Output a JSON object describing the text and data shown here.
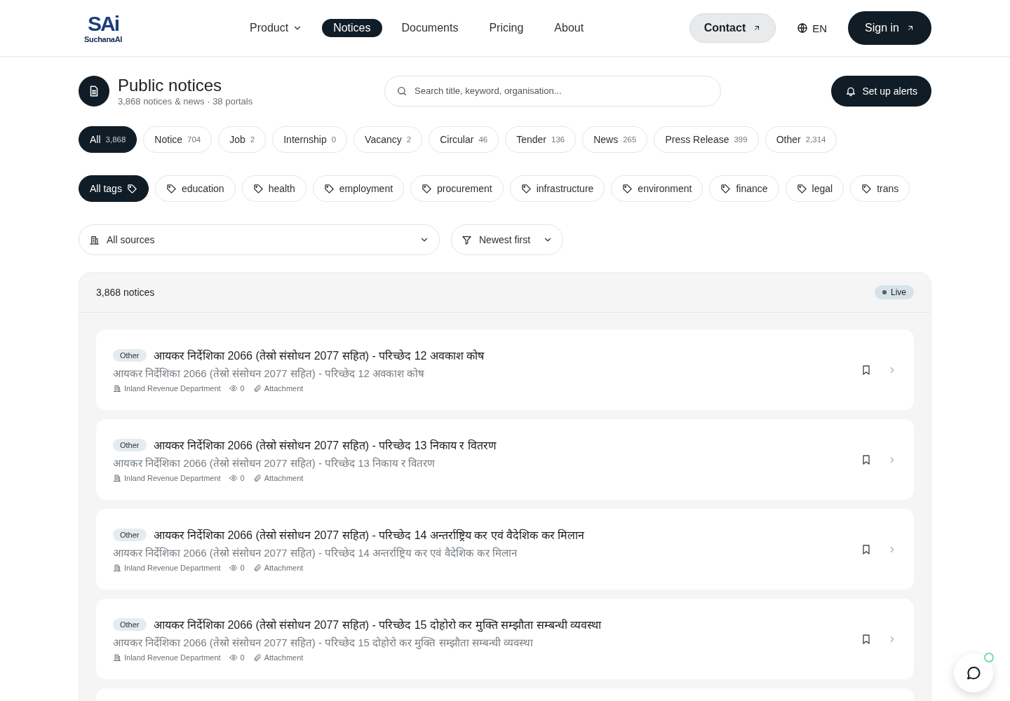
{
  "header": {
    "logo": {
      "mark": "SAi",
      "name": "SuchanaAI"
    },
    "nav": [
      {
        "label": "Product",
        "dropdown": true,
        "selected": false
      },
      {
        "label": "Notices",
        "dropdown": false,
        "selected": true
      },
      {
        "label": "Documents",
        "dropdown": false,
        "selected": false
      },
      {
        "label": "Pricing",
        "dropdown": false,
        "selected": false
      },
      {
        "label": "About",
        "dropdown": false,
        "selected": false
      }
    ],
    "contact": "Contact",
    "language": "EN",
    "sign_in": "Sign in"
  },
  "page": {
    "title": "Public notices",
    "subtitle": "3,868 notices & news · 38 portals",
    "search": {
      "placeholder": "Search title, keyword, organisation..."
    },
    "alerts_button": "Set up alerts"
  },
  "categories": [
    {
      "label": "All",
      "count": "3,868",
      "selected": true
    },
    {
      "label": "Notice",
      "count": "704",
      "selected": false
    },
    {
      "label": "Job",
      "count": "2",
      "selected": false
    },
    {
      "label": "Internship",
      "count": "0",
      "selected": false
    },
    {
      "label": "Vacancy",
      "count": "2",
      "selected": false
    },
    {
      "label": "Circular",
      "count": "46",
      "selected": false
    },
    {
      "label": "Tender",
      "count": "136",
      "selected": false
    },
    {
      "label": "News",
      "count": "265",
      "selected": false
    },
    {
      "label": "Press Release",
      "count": "399",
      "selected": false
    },
    {
      "label": "Other",
      "count": "2,314",
      "selected": false
    }
  ],
  "tags": [
    {
      "label": "All tags",
      "selected": true
    },
    {
      "label": "education",
      "selected": false
    },
    {
      "label": "health",
      "selected": false
    },
    {
      "label": "employment",
      "selected": false
    },
    {
      "label": "procurement",
      "selected": false
    },
    {
      "label": "infrastructure",
      "selected": false
    },
    {
      "label": "environment",
      "selected": false
    },
    {
      "label": "finance",
      "selected": false
    },
    {
      "label": "legal",
      "selected": false
    },
    {
      "label": "trans",
      "selected": false
    }
  ],
  "filters": {
    "source": "All sources",
    "sort": "Newest first"
  },
  "list": {
    "count": "3,868 notices",
    "status": "Live",
    "notices": [
      {
        "type": "Other",
        "title": "आयकर निर्देशिका 2066 (तेस्रो संसोधन 2077 सहित) - परिच्छेद 12 अवकाश कोष",
        "summary": "आयकर निर्देशिका 2066 (तेस्रो संसोधन 2077 सहित) - परिच्छेद 12 अवकाश कोष",
        "source": "Inland Revenue Department",
        "views": "0",
        "attachment": "Attachment"
      },
      {
        "type": "Other",
        "title": "आयकर निर्देशिका 2066 (तेस्रो संसोधन 2077 सहित) - परिच्छेद 13 निकाय र वितरण",
        "summary": "आयकर निर्देशिका 2066 (तेस्रो संसोधन 2077 सहित) - परिच्छेद 13 निकाय र वितरण",
        "source": "Inland Revenue Department",
        "views": "0",
        "attachment": "Attachment"
      },
      {
        "type": "Other",
        "title": "आयकर निर्देशिका 2066 (तेस्रो संसोधन 2077 सहित) - परिच्छेद 14 अन्तर्राष्ट्रिय कर एवं वैदेशिक कर मिलान",
        "summary": "आयकर निर्देशिका 2066 (तेस्रो संसोधन 2077 सहित) - परिच्छेद 14 अन्तर्राष्ट्रिय कर एवं वैदेशिक कर मिलान",
        "source": "Inland Revenue Department",
        "views": "0",
        "attachment": "Attachment"
      },
      {
        "type": "Other",
        "title": "आयकर निर्देशिका 2066 (तेस्रो संसोधन 2077 सहित) - परिच्छेद 15 दोहोरो कर मुक्ति सम्झौता सम्बन्धी व्यवस्था",
        "summary": "आयकर निर्देशिका 2066 (तेस्रो संसोधन 2077 सहित) - परिच्छेद 15 दोहोरो कर मुक्ति सम्झौता सम्बन्धी व्यवस्था",
        "source": "Inland Revenue Department",
        "views": "0",
        "attachment": "Attachment"
      }
    ]
  },
  "chat": {
    "online": true
  }
}
